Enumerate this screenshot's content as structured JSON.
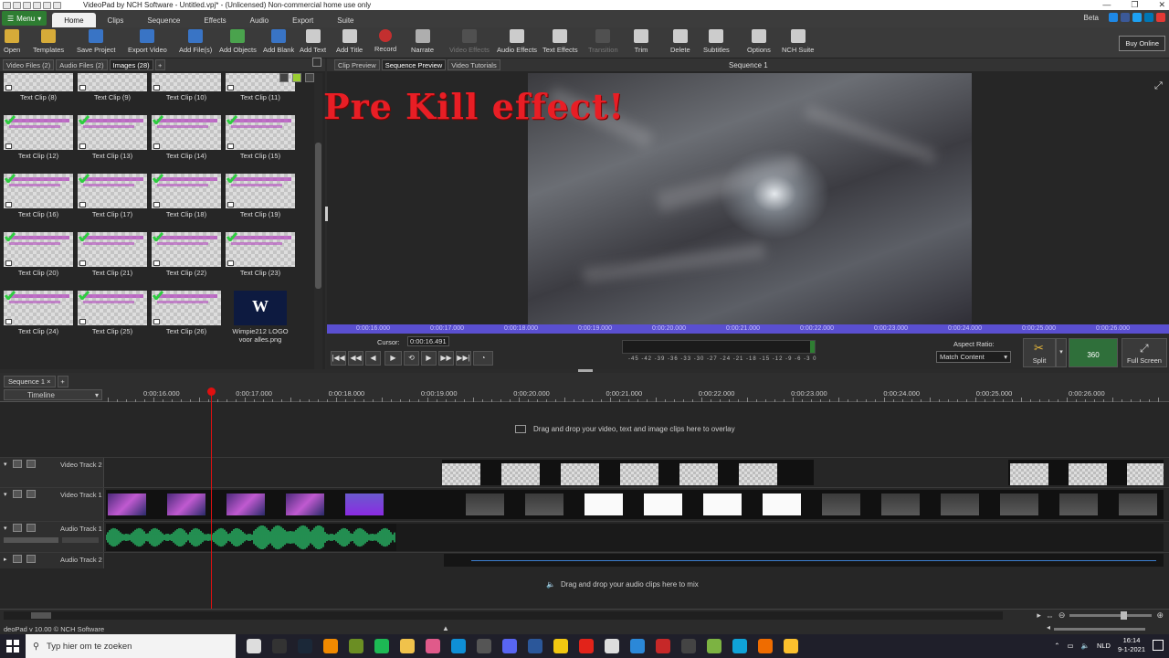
{
  "window": {
    "title": "VideoPad by NCH Software - Untitled.vpj* - (Unlicensed) Non-commercial home use only",
    "controls": [
      "—",
      "❐",
      "✕"
    ]
  },
  "menubar": {
    "menu_label": "Menu",
    "tabs": [
      "Home",
      "Clips",
      "Sequence",
      "Effects",
      "Audio",
      "Export",
      "Suite"
    ],
    "active_tab": "Home",
    "beta_label": "Beta",
    "social_icons": [
      "thumbs-up-icon",
      "facebook-icon",
      "twitter-icon",
      "linkedin-icon",
      "youtube-icon"
    ]
  },
  "toolbar": {
    "buttons": [
      {
        "label": "Open",
        "icon": "folder-open-icon",
        "color": "#e8b83a",
        "disabled": false
      },
      {
        "label": "Templates",
        "icon": "templates-icon",
        "color": "#e8b83a",
        "disabled": false
      },
      {
        "label": "Save Project",
        "icon": "save-icon",
        "color": "#3a7bd5",
        "disabled": false
      },
      {
        "label": "Export Video",
        "icon": "export-video-icon",
        "color": "#3a7bd5",
        "disabled": false
      },
      {
        "label": "Add File(s)",
        "icon": "add-file-icon",
        "color": "#3a7bd5",
        "disabled": false
      },
      {
        "label": "Add Objects",
        "icon": "add-objects-icon",
        "color": "#4caf50",
        "disabled": false
      },
      {
        "label": "Add Blank",
        "icon": "add-blank-icon",
        "color": "#3a7bd5",
        "disabled": false
      },
      {
        "label": "Add Text",
        "icon": "add-text-icon",
        "color": "#dddddd",
        "disabled": false
      },
      {
        "label": "Add Title",
        "icon": "add-title-icon",
        "color": "#dddddd",
        "disabled": false
      },
      {
        "label": "Record",
        "icon": "record-icon",
        "color": "#d32f2f",
        "disabled": false
      },
      {
        "label": "Narrate",
        "icon": "microphone-icon",
        "color": "#bbbbbb",
        "disabled": false
      },
      {
        "label": "Video Effects",
        "icon": "video-effects-icon",
        "color": "#666666",
        "disabled": true
      },
      {
        "label": "Audio Effects",
        "icon": "audio-effects-icon",
        "color": "#dddddd",
        "disabled": false
      },
      {
        "label": "Text Effects",
        "icon": "text-effects-icon",
        "color": "#dddddd",
        "disabled": false
      },
      {
        "label": "Transition",
        "icon": "transition-icon",
        "color": "#666666",
        "disabled": true
      },
      {
        "label": "Trim",
        "icon": "trim-icon",
        "color": "#dddddd",
        "disabled": false
      },
      {
        "label": "Delete",
        "icon": "trash-icon",
        "color": "#dddddd",
        "disabled": false
      },
      {
        "label": "Subtitles",
        "icon": "subtitles-icon",
        "color": "#dddddd",
        "disabled": false
      },
      {
        "label": "Options",
        "icon": "options-icon",
        "color": "#dddddd",
        "disabled": false
      },
      {
        "label": "NCH Suite",
        "icon": "nch-suite-icon",
        "color": "#dddddd",
        "disabled": false
      }
    ],
    "buy_online": "Buy Online"
  },
  "bin": {
    "tabs": [
      {
        "label": "Video Files",
        "badge": "(2)"
      },
      {
        "label": "Audio Files",
        "badge": "(2)"
      },
      {
        "label": "Images",
        "badge": "(28)"
      }
    ],
    "active_tab": "Images",
    "clips": [
      "Text Clip (8)",
      "Text Clip (9)",
      "Text Clip (10)",
      "Text Clip (11)",
      "Text Clip (12)",
      "Text Clip (13)",
      "Text Clip (14)",
      "Text Clip (15)",
      "Text Clip (16)",
      "Text Clip (17)",
      "Text Clip (18)",
      "Text Clip (19)",
      "Text Clip (20)",
      "Text Clip (21)",
      "Text Clip (22)",
      "Text Clip (23)",
      "Text Clip (24)",
      "Text Clip (25)",
      "Text Clip (26)",
      "Wimpie212 LOGO voor alles.png"
    ],
    "logo_glyph": "W"
  },
  "preview": {
    "tabs": [
      "Clip Preview",
      "Sequence Preview",
      "Video Tutorials"
    ],
    "active_tab": "Sequence Preview",
    "title": "Sequence 1",
    "overlay_text": "Pre Kill effect!",
    "overlay_color": "#e81e25",
    "ruler_ticks": [
      "0:00:16.000",
      "0:00:17.000",
      "0:00:18.000",
      "0:00:19.000",
      "0:00:20.000",
      "0:00:21.000",
      "0:00:22.000",
      "0:00:23.000",
      "0:00:24.000",
      "0:00:25.000",
      "0:00:26.000"
    ],
    "cursor_label": "Cursor:",
    "cursor_value": "0:00:16.491",
    "controls": [
      "|◀◀",
      "◀◀",
      "◀",
      "▶",
      "⟲",
      "▶",
      "▶▶",
      "▶▶|",
      "◔"
    ],
    "meter_scale": "-45 -42 -39 -36 -33 -30 -27 -24 -21 -18 -15 -12 -9 -6 -3 0",
    "aspect_label": "Aspect Ratio:",
    "aspect_value": "Match Content",
    "split_label": "Split",
    "btn_360": "360",
    "fullscreen_label": "Full Screen"
  },
  "sequence": {
    "tabs": [
      "Sequence 1"
    ],
    "timeline_label": "Timeline",
    "ticks": [
      "0:00:16.000",
      "0:00:17.000",
      "0:00:18.000",
      "0:00:19.000",
      "0:00:20.000",
      "0:00:21.000",
      "0:00:22.000",
      "0:00:23.000",
      "0:00:24.000",
      "0:00:25.000",
      "0:00:26.000"
    ],
    "overlay_hint": "Drag and drop your video, text and image clips here to overlay",
    "audio_hint": "Drag and drop your audio clips here to mix",
    "tracks": [
      "Video Track 2",
      "Video Track 1",
      "Audio Track 1",
      "Audio Track 2"
    ]
  },
  "status": {
    "version": "deoPad v 10.00 © NCH Software"
  },
  "taskbar": {
    "search_placeholder": "Typ hier om te zoeken",
    "language": "NLD",
    "time": "16:14",
    "date": "9-1-2021",
    "app_icons": [
      {
        "name": "task-view-icon",
        "color": "#dddddd"
      },
      {
        "name": "epic-games-icon",
        "color": "#333333"
      },
      {
        "name": "steam-icon",
        "color": "#1b2838"
      },
      {
        "name": "vlc-icon",
        "color": "#f08a00"
      },
      {
        "name": "minecraft-icon",
        "color": "#6b8e23"
      },
      {
        "name": "spotify-icon",
        "color": "#1db954"
      },
      {
        "name": "file-explorer-icon",
        "color": "#f0c24b"
      },
      {
        "name": "snipping-icon",
        "color": "#e05a8a"
      },
      {
        "name": "edge-icon",
        "color": "#0f8fd6"
      },
      {
        "name": "obs-icon",
        "color": "#555555"
      },
      {
        "name": "discord-icon",
        "color": "#5865f2"
      },
      {
        "name": "word-icon",
        "color": "#2b579a"
      },
      {
        "name": "sticky-icon",
        "color": "#f2c811"
      },
      {
        "name": "roblox-icon",
        "color": "#e2231a"
      },
      {
        "name": "notepad-icon",
        "color": "#dddddd"
      },
      {
        "name": "store-icon",
        "color": "#2b88d8"
      },
      {
        "name": "mail-icon",
        "color": "#c62828"
      },
      {
        "name": "nch-icon",
        "color": "#444444"
      },
      {
        "name": "minecraft-dungeons-icon",
        "color": "#7cb342"
      },
      {
        "name": "gog-icon",
        "color": "#0fa3d8"
      },
      {
        "name": "aseprite-icon",
        "color": "#ef6c00"
      },
      {
        "name": "videopad-icon",
        "color": "#fbc02d"
      }
    ]
  }
}
